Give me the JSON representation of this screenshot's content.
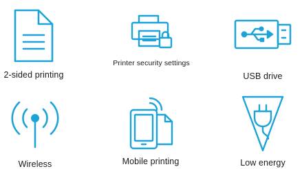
{
  "accent_color": "#1ea3d8",
  "features": [
    {
      "icon": "document-icon",
      "label": "2-sided printing"
    },
    {
      "icon": "printer-lock-icon",
      "label": "Printer security settings"
    },
    {
      "icon": "usb-drive-icon",
      "label": "USB drive"
    },
    {
      "icon": "wireless-icon",
      "label": "Wireless"
    },
    {
      "icon": "mobile-printing-icon",
      "label": "Mobile printing"
    },
    {
      "icon": "low-energy-icon",
      "label": "Low energy"
    }
  ]
}
